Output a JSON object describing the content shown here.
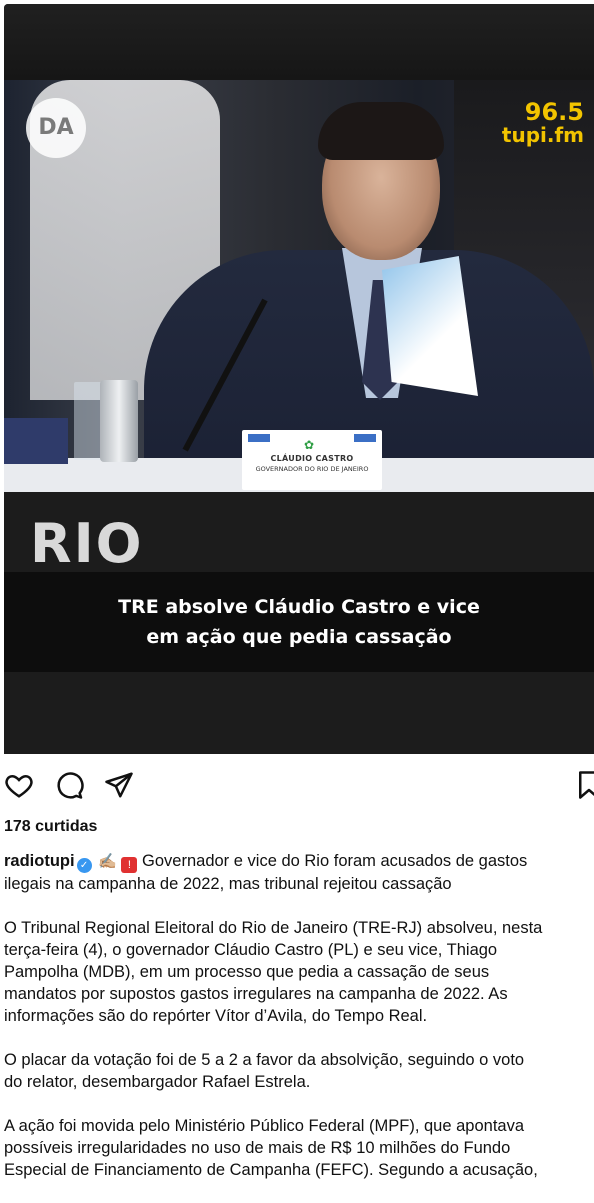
{
  "post": {
    "image": {
      "logo_left": "DA",
      "logo_right_freq": "96.5",
      "logo_right_brand": "tupi.fm",
      "nameplate_name": "CLÁUDIO CASTRO",
      "nameplate_role": "GOVERNADOR DO RIO DE JANEIRO",
      "section_label": "RIO",
      "headline_line1": "TRE absolve Cláudio Castro e vice",
      "headline_line2": "em ação que pedia cassação"
    },
    "likes_text": "178 curtidas",
    "username": "radiotupi",
    "caption_first_line": "Governador e vice do Rio foram acusados de gastos",
    "caption_second_line": "ilegais na campanha de 2022, mas tribunal rejeitou cassação",
    "paragraph1": [
      "O Tribunal Regional Eleitoral do Rio de Janeiro (TRE-RJ) absolveu, nesta",
      "terça-feira (4), o governador Cláudio Castro (PL) e seu vice, Thiago",
      "Pampolha (MDB), em um processo que pedia a cassação de seus",
      "mandatos por supostos gastos irregulares na campanha de 2022. As",
      "informações são do repórter Vítor d’Avila, do Tempo Real."
    ],
    "paragraph2": [
      "O placar da votação foi de 5 a 2 a favor da absolvição, seguindo o voto",
      "do relator, desembargador Rafael Estrela."
    ],
    "paragraph3": [
      "A ação foi movida pelo Ministério Público Federal (MPF), que apontava",
      "possíveis irregularidades no uso de mais de R$ 10 milhões do Fundo",
      "Especial de Financiamento de Campanha (FEFC). Segundo a acusação,"
    ]
  },
  "icons": {
    "like": "heart-icon",
    "comment": "comment-bubble-icon",
    "share": "paper-plane-icon",
    "save": "bookmark-icon",
    "verified": "verified-badge-icon"
  }
}
